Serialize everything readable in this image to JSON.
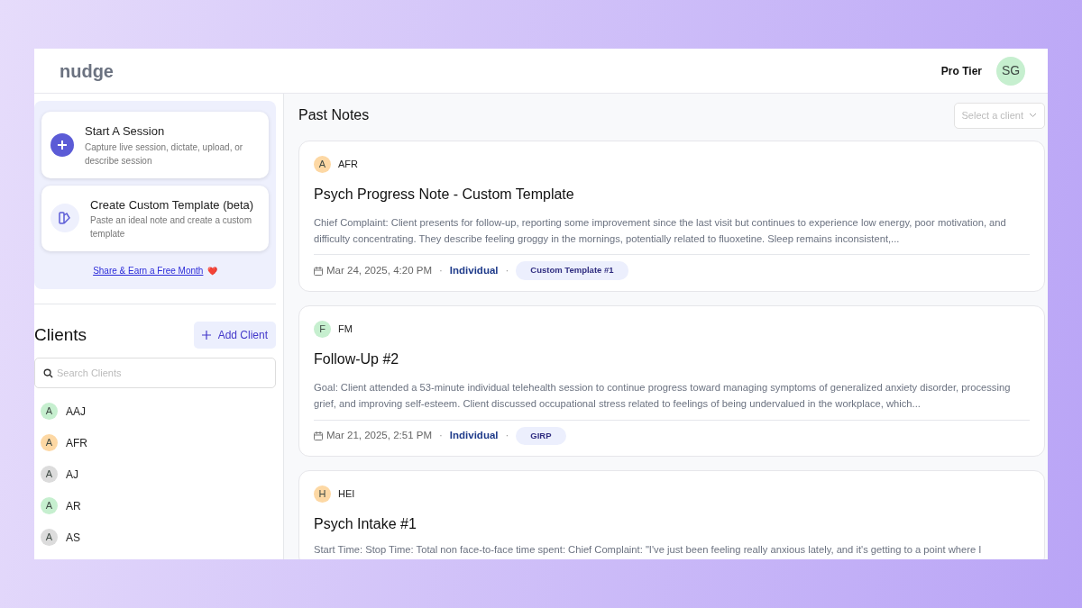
{
  "header": {
    "logo": "nudge",
    "tier": "Pro Tier",
    "avatar": "SG"
  },
  "actions": [
    {
      "kind": "session",
      "title": "Start A Session",
      "description": "Capture live session, dictate, upload, or describe session"
    },
    {
      "kind": "template",
      "title": "Create Custom Template (beta)",
      "description": "Paste an ideal note and create a custom template"
    }
  ],
  "share_link": "Share & Earn a Free Month",
  "share_emoji": "❤️",
  "clients": {
    "title": "Clients",
    "add_button": "Add Client",
    "search": {
      "placeholder": "Search Clients"
    },
    "items": [
      {
        "initial": "A",
        "name": "AAJ",
        "color": "#c6efcf"
      },
      {
        "initial": "A",
        "name": "AFR",
        "color": "#fdd8a4"
      },
      {
        "initial": "A",
        "name": "AJ",
        "color": "#dcdcdc"
      },
      {
        "initial": "A",
        "name": "AR",
        "color": "#c6efcf"
      },
      {
        "initial": "A",
        "name": "AS",
        "color": "#dcdcdc"
      }
    ]
  },
  "notes": {
    "title": "Past Notes",
    "filter": {
      "placeholder": "Select a client"
    },
    "items": [
      {
        "initial": "A",
        "client": "AFR",
        "color": "#fdd8a4",
        "title": "Psych Progress Note - Custom Template",
        "body": "Chief Complaint: Client presents for follow-up, reporting some improvement since the last visit but continues to experience low energy, poor motivation, and difficulty concentrating. They describe feeling groggy in the mornings, potentially related to fluoxetine. Sleep remains inconsistent,...",
        "date": "Mar 24, 2025, 4:20 PM",
        "separators": [
          "·",
          "·"
        ],
        "type": "Individual",
        "template": "Custom Template #1"
      },
      {
        "initial": "F",
        "client": "FM",
        "color": "#c6efcf",
        "title": "Follow-Up #2",
        "body": "Goal: Client attended a 53-minute individual telehealth session to continue progress toward managing symptoms of generalized anxiety disorder, processing grief, and improving self-esteem. Client discussed occupational stress related to feelings of being undervalued in the workplace, which...",
        "date": "Mar 21, 2025, 2:51 PM",
        "separators": [
          "·",
          "·"
        ],
        "type": "Individual",
        "template": "GIRP"
      },
      {
        "initial": "H",
        "client": "HEI",
        "color": "#fdd8a4",
        "title": "Psych Intake #1",
        "body": "Start Time: Stop Time: Total non face-to-face time spent: Chief Complaint: \"I've just been feeling really anxious lately, and it's getting to a point where I"
      }
    ]
  }
}
